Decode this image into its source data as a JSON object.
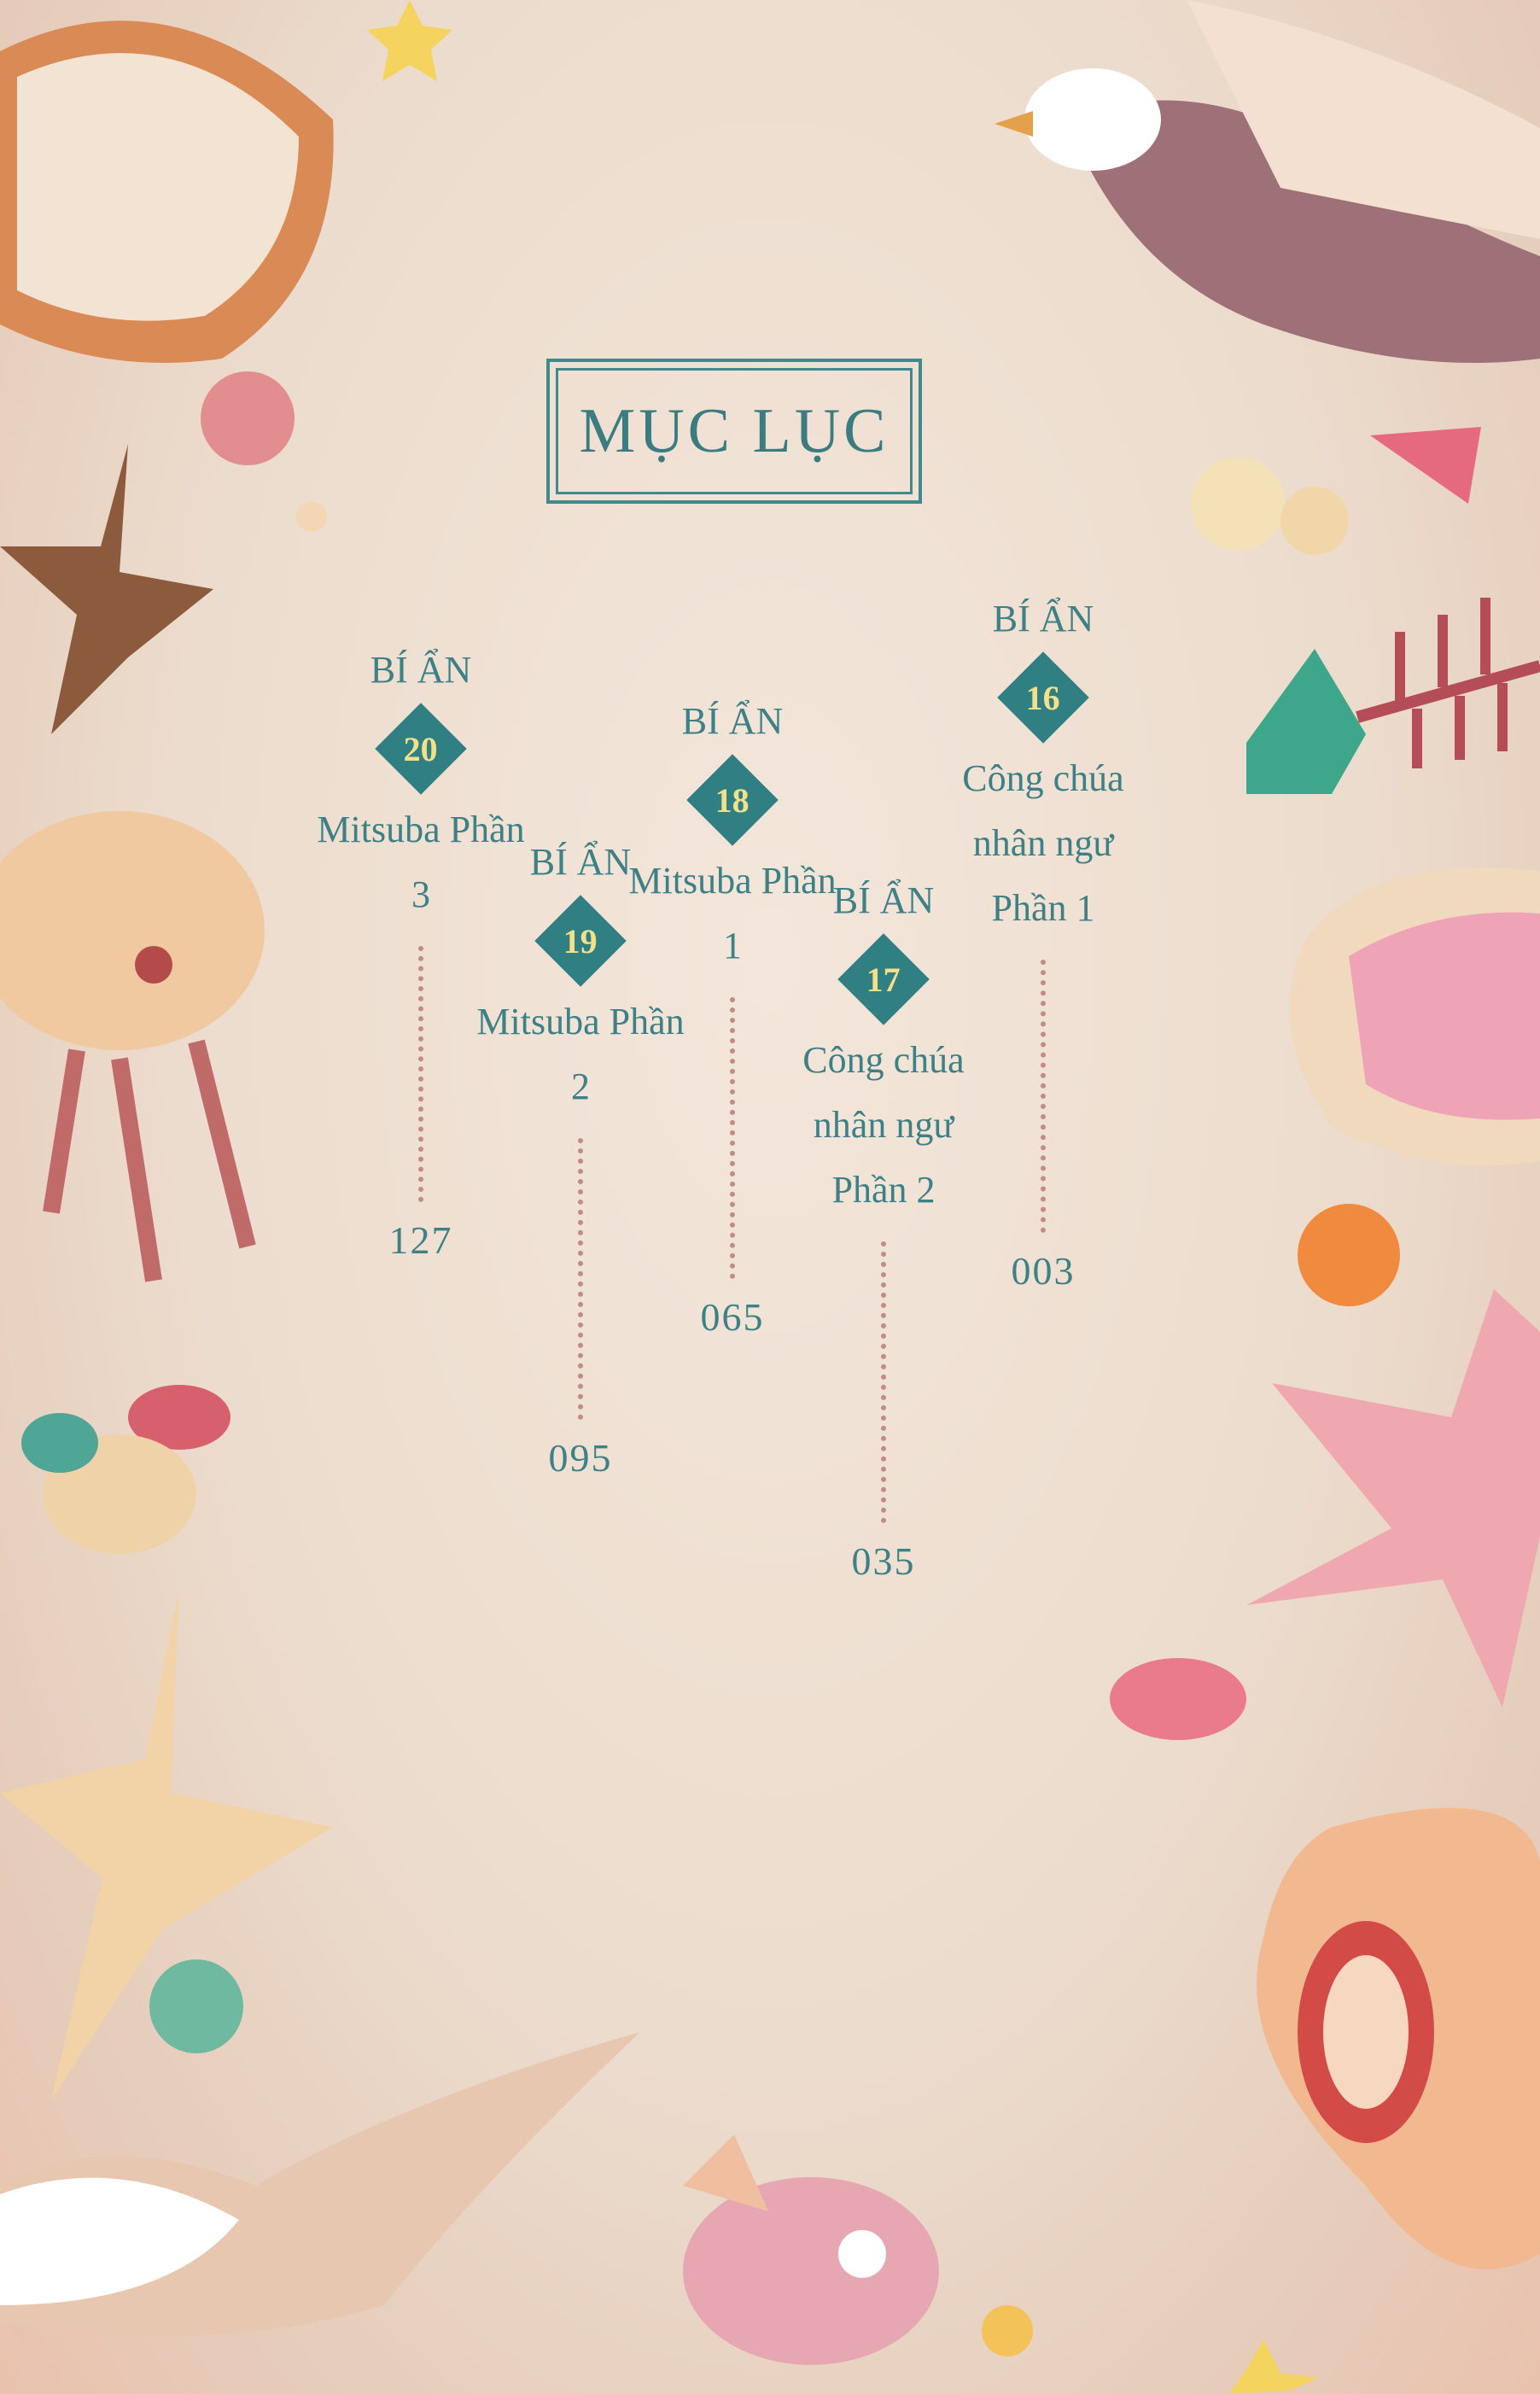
{
  "title": "MỤC LỤC",
  "entries": [
    {
      "label": "BÍ ẨN",
      "number": "20",
      "name": "Mitsuba Phần 3",
      "page": "127"
    },
    {
      "label": "BÍ ẨN",
      "number": "19",
      "name": "Mitsuba Phần 2",
      "page": "095"
    },
    {
      "label": "BÍ ẨN",
      "number": "18",
      "name": "Mitsuba Phần 1",
      "page": "065"
    },
    {
      "label": "BÍ ẨN",
      "number": "17",
      "name": "Công chúa nhân ngư Phần 2",
      "page": "035"
    },
    {
      "label": "BÍ ẨN",
      "number": "16",
      "name": "Công chúa nhân ngư Phần 1",
      "page": "003"
    }
  ],
  "colors": {
    "accent": "#3a7c80",
    "diamond": "#2f7f83",
    "diamond_text": "#f2e08a",
    "dots": "#c08d86"
  },
  "decorations": [
    "scallop-shell",
    "starfish",
    "seagull",
    "jellyfish",
    "fish-bone",
    "pearl",
    "fish",
    "conch-shell"
  ]
}
